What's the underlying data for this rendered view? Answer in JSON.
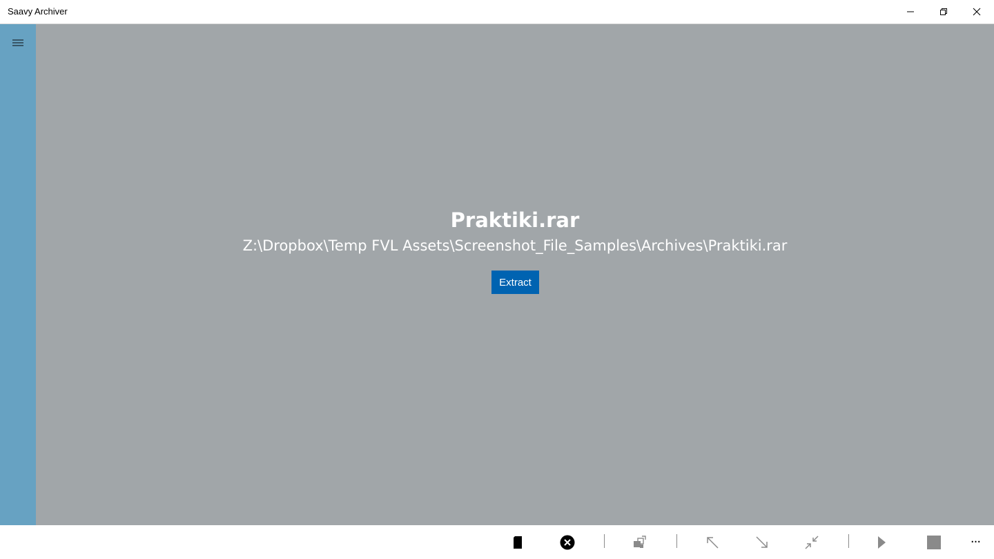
{
  "window": {
    "title": "Saavy Archiver"
  },
  "caption_buttons": {
    "minimize": "minimize-icon",
    "restore": "restore-icon",
    "close": "close-icon"
  },
  "sidenav": {
    "menu_icon": "hamburger-icon",
    "background": "#67a2c2"
  },
  "main": {
    "background": "#a1a6a9",
    "archive": {
      "name": "Praktiki.rar",
      "path": "Z:\\Dropbox\\Temp FVL Assets\\Screenshot_File_Samples\\Archives\\Praktiki.rar"
    },
    "extract_button": {
      "label": "Extract",
      "color": "#0063b1"
    }
  },
  "command_bar": {
    "items": [
      {
        "icon": "new-archive-icon",
        "enabled": true
      },
      {
        "icon": "close-archive-icon",
        "enabled": true
      },
      {
        "icon": "swap-icon",
        "enabled": false
      },
      {
        "icon": "arrow-up-left-icon",
        "enabled": false
      },
      {
        "icon": "arrow-down-right-icon",
        "enabled": false
      },
      {
        "icon": "collapse-icon",
        "enabled": false
      },
      {
        "icon": "play-icon",
        "enabled": false
      },
      {
        "icon": "stop-icon",
        "enabled": false
      },
      {
        "icon": "more-icon",
        "enabled": true
      }
    ],
    "more_glyph": "···"
  }
}
